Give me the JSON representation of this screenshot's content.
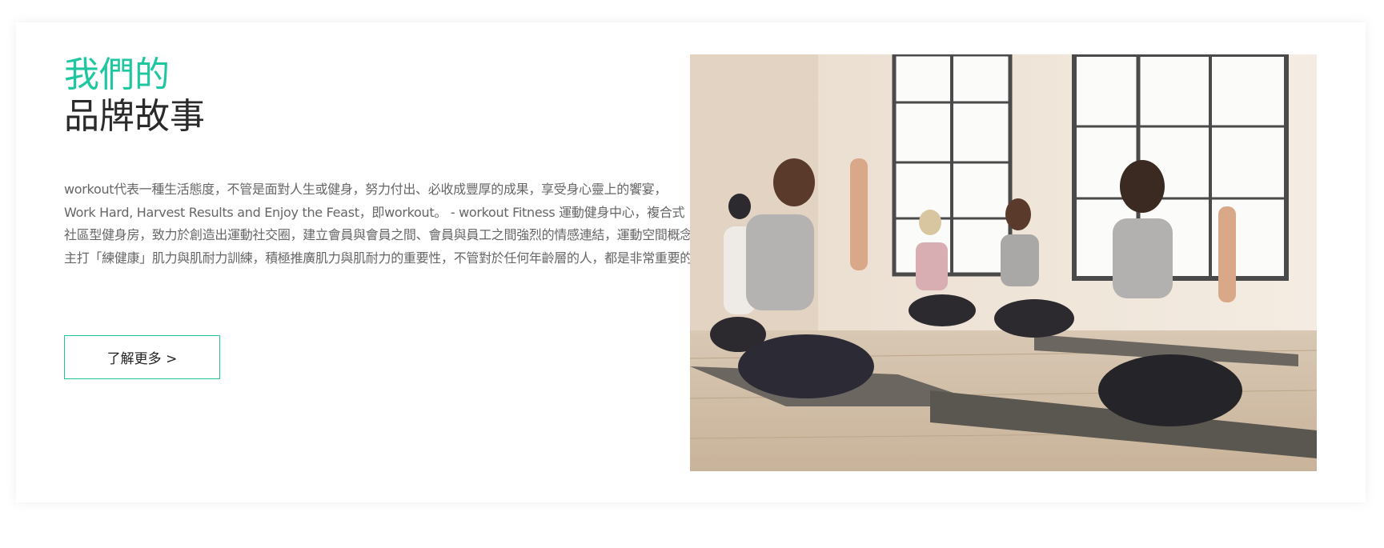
{
  "brand_story": {
    "heading_accent": "我們的",
    "heading_main": "品牌故事",
    "description": "workout代表一種生活態度，不管是面對人生或健身，努力付出、必收成豐厚的成果，享受身心靈上的饗宴，Work Hard, Harvest Results and Enjoy the Feast，即workout。 - workout Fitness 運動健身中心，複合式社區型健身房，致力於創造出運動社交圈，建立會員與會員之間、會員與員工之間強烈的情感連結，運動空間概念主打「練健康」肌力與肌耐力訓練，積極推廣肌力與肌耐力的重要性，不管對於任何年齡層的人，都是非常重要的",
    "more_button": "了解更多 >"
  },
  "colors": {
    "accent": "#1fc7a0",
    "heading_text": "#2a2a2a",
    "body_text": "#666666"
  }
}
